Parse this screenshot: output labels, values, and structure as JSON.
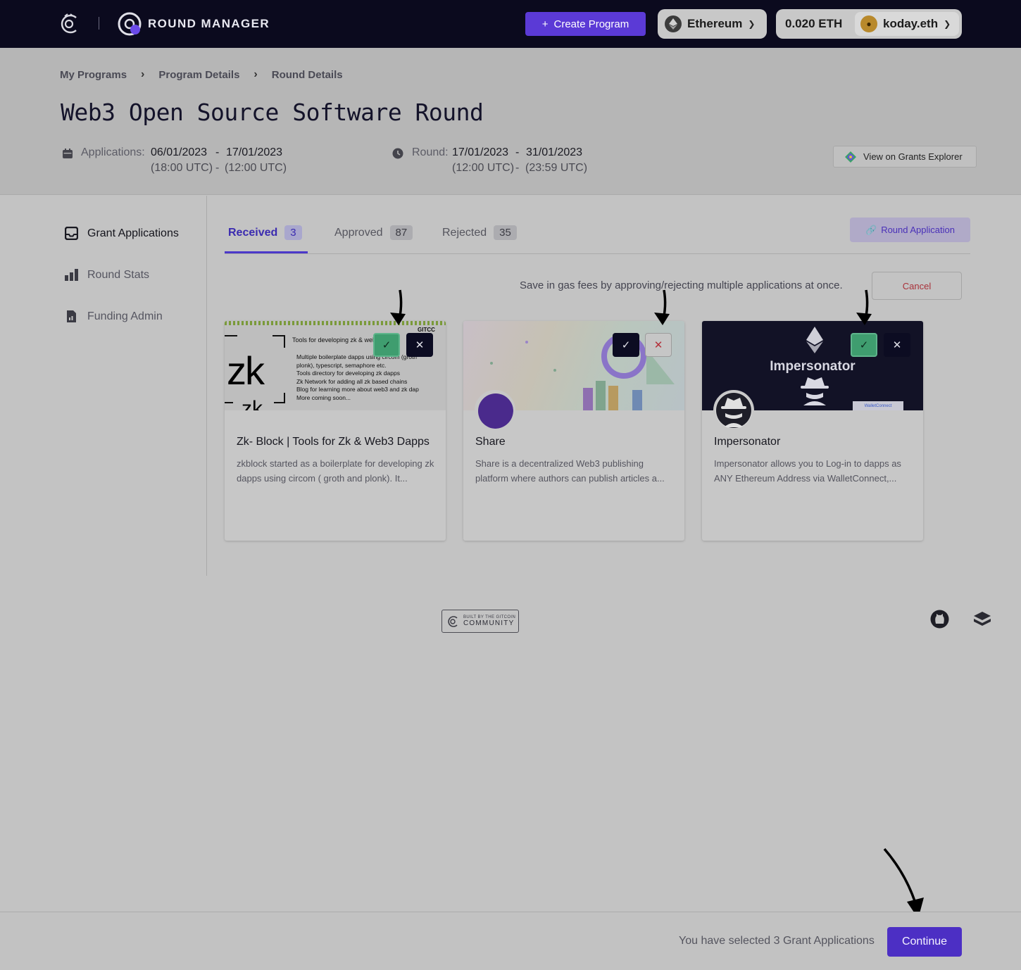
{
  "nav": {
    "brand": "ROUND MANAGER",
    "create_program": "Create Program",
    "network": "Ethereum",
    "balance": "0.020 ETH",
    "account": "koday.eth"
  },
  "breadcrumb": [
    "My Programs",
    "Program Details",
    "Round Details"
  ],
  "page_title": "Web3 Open Source Software Round",
  "dates": {
    "applications_label": "Applications:",
    "applications_start": "06/01/2023",
    "applications_end": "17/01/2023",
    "applications_start_time": "(18:00 UTC)",
    "applications_end_time": "(12:00 UTC)",
    "round_label": "Round:",
    "round_start": "17/01/2023",
    "round_end": "31/01/2023",
    "round_start_time": "(12:00 UTC)",
    "round_end_time": "(23:59 UTC)",
    "dash": "-"
  },
  "view_explorer": "View on Grants Explorer",
  "sidebar": {
    "items": [
      {
        "label": "Grant Applications",
        "icon": "inbox-icon"
      },
      {
        "label": "Round Stats",
        "icon": "bar-chart-icon"
      },
      {
        "label": "Funding Admin",
        "icon": "document-chart-icon"
      }
    ]
  },
  "tabs": [
    {
      "label": "Received",
      "count": "3"
    },
    {
      "label": "Approved",
      "count": "87"
    },
    {
      "label": "Rejected",
      "count": "35"
    }
  ],
  "round_application": "Round Application",
  "save_note": "Save in gas fees by approving/rejecting multiple applications at once.",
  "cancel": "Cancel",
  "cards": [
    {
      "title": "Zk- Block | Tools for Zk & Web3 Dapps",
      "description": "zkblock started as a boilerplate for developing zk dapps using circom ( groth and plonk). It...",
      "banner": {
        "logo_big": "zk",
        "logo_small": "zk",
        "heading": "Tools for developing zk & web3 dapps",
        "bullets": [
          "Multiple boilerplate dapps using circom (groth",
          "plonk), typescript, semaphore etc.",
          "Tools directory for developing zk dapps",
          "Zk Network for adding all zk based chains",
          "Blog for learning more about web3 and zk dap",
          "More coming soon..."
        ],
        "corner": "GITCC"
      },
      "state": "approved"
    },
    {
      "title": "Share",
      "description": "Share is a decentralized Web3 publishing platform where authors can publish articles a...",
      "state": "rejected"
    },
    {
      "title": "Impersonator",
      "description": "Impersonator allows you to Log-in to dapps as ANY Ethereum Address via WalletConnect,...",
      "banner": {
        "heading": "Impersonator",
        "badge": "WalletConnect"
      },
      "state": "approved"
    }
  ],
  "footer": {
    "community_small": "BUILT BY THE GITCOIN",
    "community_big": "COMMUNITY"
  },
  "bottom": {
    "selected_text": "You have selected 3 Grant Applications",
    "continue": "Continue"
  },
  "colors": {
    "nav_bg": "#0b0a1e",
    "primary": "#5b3ad6",
    "approve": "#3f9d6f",
    "reject": "#b4303a"
  }
}
